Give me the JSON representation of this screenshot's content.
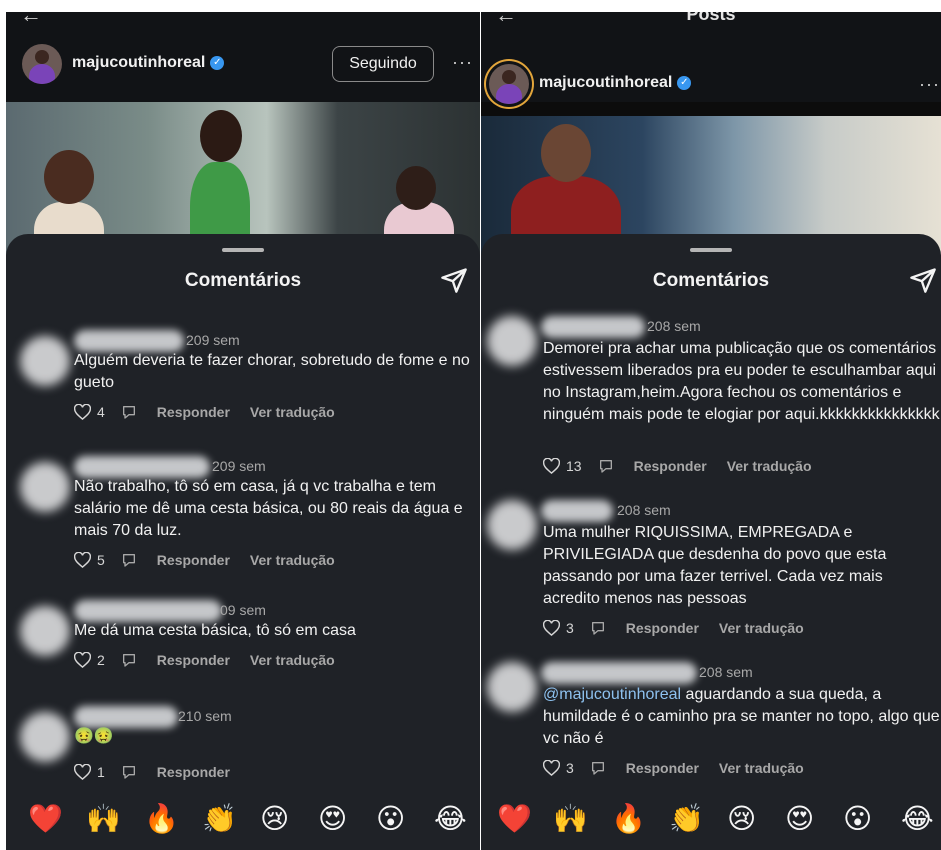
{
  "left": {
    "topbar_title": "",
    "username": "majucoutinhoreal",
    "follow_label": "Seguindo",
    "more_label": "···",
    "sheet_title": "Comentários",
    "comments": [
      {
        "time": "209 sem",
        "text": "Alguém deveria te fazer chorar, sobretudo de fome e no gueto",
        "likes": "4",
        "reply": "Responder",
        "translate": "Ver tradução"
      },
      {
        "time": "209 sem",
        "text": "Não trabalho, tô só em casa, já q vc trabalha e tem salário me dê uma cesta básica, ou 80 reais da água e mais 70 da luz.",
        "likes": "5",
        "reply": "Responder",
        "translate": "Ver tradução"
      },
      {
        "time": "09 sem",
        "text": "Me dá uma cesta básica, tô só em casa",
        "likes": "2",
        "reply": "Responder",
        "translate": "Ver tradução"
      },
      {
        "time": "210 sem",
        "text": "🤢🤢",
        "likes": "1",
        "reply": "Responder",
        "translate": ""
      }
    ],
    "emojis": [
      "❤️",
      "🙌",
      "🔥",
      "👏",
      "😢",
      "😍",
      "😮",
      "😂"
    ]
  },
  "right": {
    "topbar_title": "Posts",
    "username": "majucoutinhoreal",
    "more_label": "···",
    "sheet_title": "Comentários",
    "comments": [
      {
        "time": "208 sem",
        "text": "Demorei pra achar uma publicação que os comentários estivessem liberados pra eu poder te esculhambar aqui no Instagram,heim.Agora fechou os comentários e ninguém mais pode te elogiar por aqui.kkkkkkkkkkkkkkk",
        "likes": "13",
        "reply": "Responder",
        "translate": "Ver tradução"
      },
      {
        "time": "208 sem",
        "text": "Uma mulher RIQUISSIMA, EMPREGADA e PRIVILEGIADA que desdenha do povo que esta passando por uma fazer terrivel. Cada vez mais acredito menos nas pessoas",
        "likes": "3",
        "reply": "Responder",
        "translate": "Ver tradução"
      },
      {
        "time": "208 sem",
        "mention": "@majucoutinhoreal",
        "text": " aguardando a sua queda, a humildade é o caminho pra se manter no topo, algo que vc não é",
        "likes": "3",
        "reply": "Responder",
        "translate": "Ver tradução"
      }
    ],
    "emojis": [
      "❤️",
      "🙌",
      "🔥",
      "👏",
      "😢",
      "😍",
      "😮",
      "😂"
    ]
  },
  "colors": {
    "sheet_bg": "#1f2227",
    "mention": "#8ec1ef",
    "verified": "#3897f0",
    "secondary_text": "#a8a8a8"
  }
}
